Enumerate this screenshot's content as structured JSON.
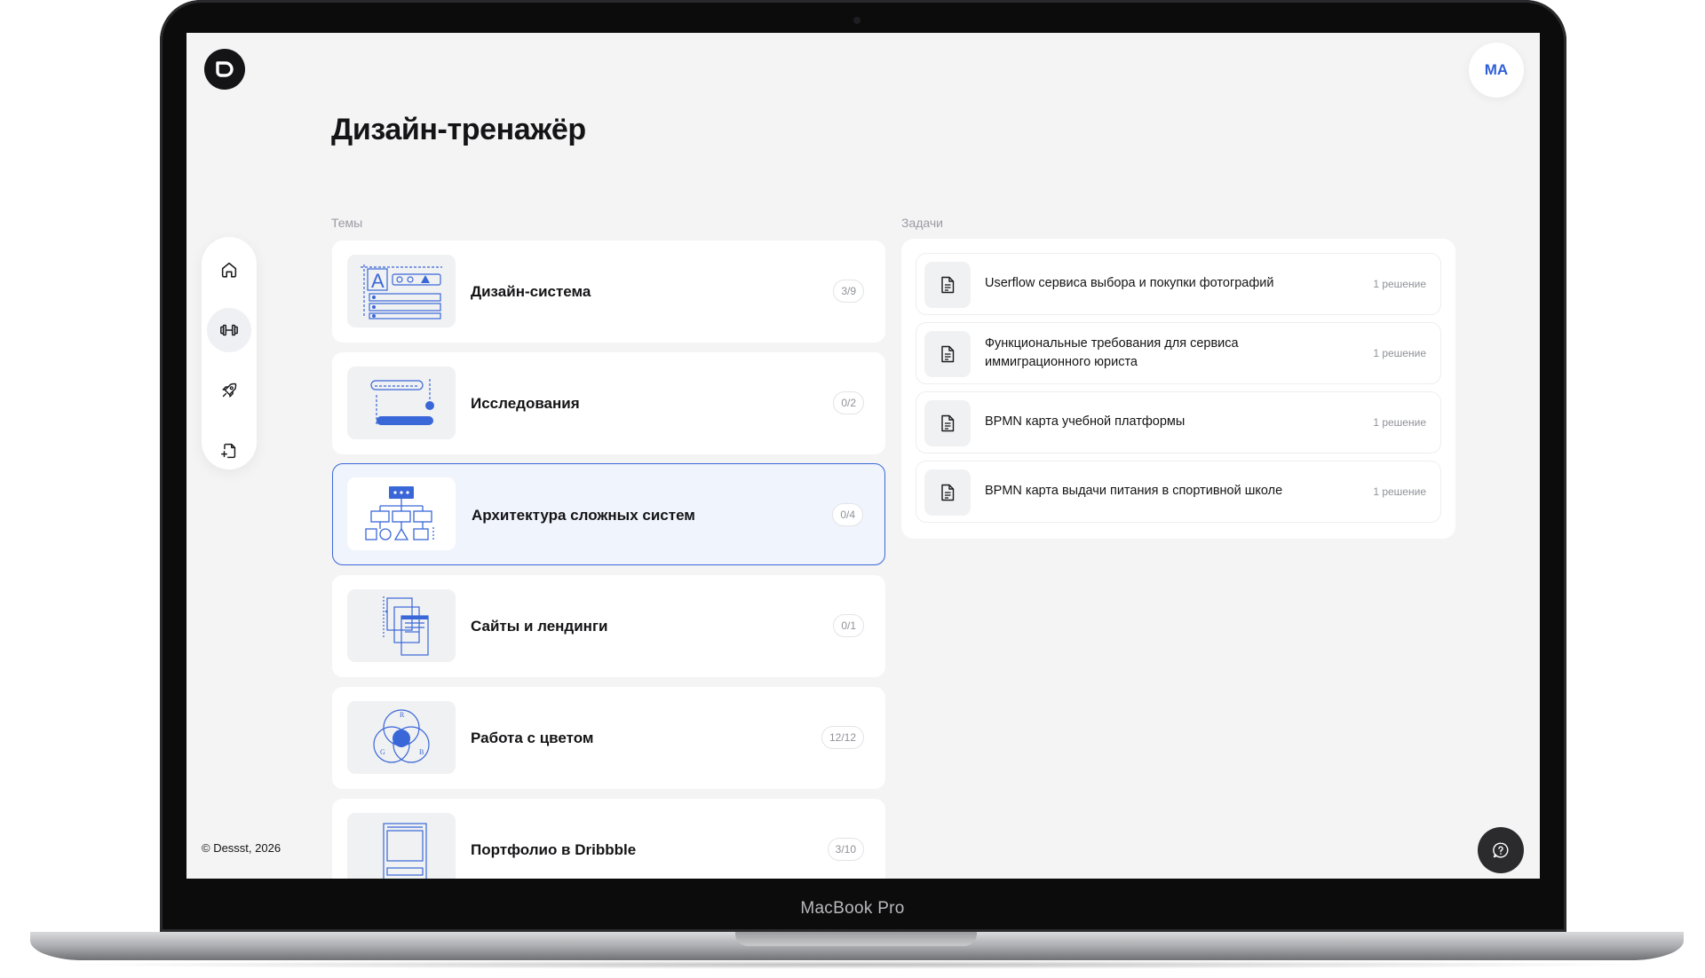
{
  "device": {
    "label": "MacBook Pro"
  },
  "app": {
    "avatar_initials": "MA",
    "page_title": "Дизайн-тренажёр",
    "copyright": "© Dessst, 2026",
    "accent_color": "#3a67d8"
  },
  "nav": {
    "items": [
      {
        "icon": "home-icon",
        "active": false
      },
      {
        "icon": "dumbbell-icon",
        "active": true
      },
      {
        "icon": "rocket-icon",
        "active": false
      },
      {
        "icon": "file-sparkle-icon",
        "active": false
      }
    ]
  },
  "topics": {
    "label": "Темы",
    "items": [
      {
        "title": "Дизайн-система",
        "progress": "3/9",
        "icon": "design-system-illustration"
      },
      {
        "title": "Исследования",
        "progress": "0/2",
        "icon": "research-illustration"
      },
      {
        "title": "Архитектура сложных систем",
        "progress": "0/4",
        "icon": "architecture-illustration",
        "selected": true
      },
      {
        "title": "Сайты и лендинги",
        "progress": "0/1",
        "icon": "websites-illustration"
      },
      {
        "title": "Работа с цветом",
        "progress": "12/12",
        "icon": "color-wheel-illustration"
      },
      {
        "title": "Портфолио в Dribbble",
        "progress": "3/10",
        "icon": "portfolio-illustration"
      }
    ]
  },
  "tasks": {
    "label": "Задачи",
    "items": [
      {
        "title": "Userflow сервиса выбора и покупки фотографий",
        "solutions": "1 решение"
      },
      {
        "title": "Функциональные требования для сервиса иммиграционного юриста",
        "solutions": "1 решение"
      },
      {
        "title": "BPMN карта учебной платформы",
        "solutions": "1 решение"
      },
      {
        "title": "BPMN карта выдачи питания в спортивной школе",
        "solutions": "1 решение"
      }
    ]
  }
}
